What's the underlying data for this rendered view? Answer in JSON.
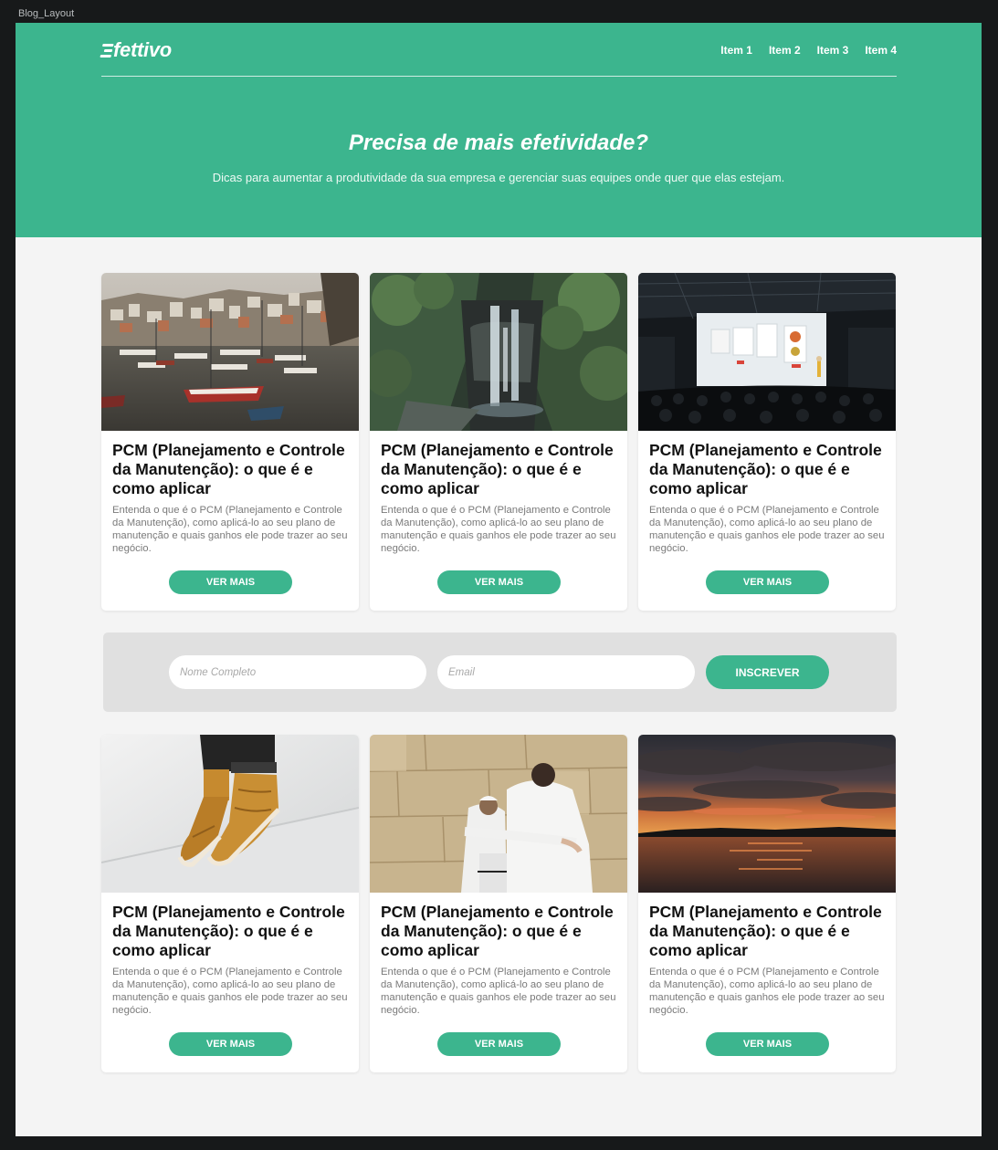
{
  "frame": {
    "label": "Blog_Layout"
  },
  "header": {
    "logo_text": "fettivo",
    "nav": [
      "Item 1",
      "Item 2",
      "Item 3",
      "Item 4"
    ]
  },
  "hero": {
    "title": "Precisa de mais efetividade?",
    "subtitle": "Dicas para aumentar a produtividade da sua empresa e gerenciar suas equipes onde quer que elas estejam."
  },
  "posts": [
    {
      "title": "PCM (Planejamento e Controle da Manutenção): o que é e como aplicar",
      "description": "Entenda o que é o PCM (Planejamento e Controle da Manutenção), como aplicá-lo ao seu plano de manutenção e quais ganhos ele pode trazer ao seu negócio.",
      "button": "VER MAIS",
      "image": "harbor-photo"
    },
    {
      "title": "PCM (Planejamento e Controle da Manutenção): o que é e como aplicar",
      "description": "Entenda o que é o PCM (Planejamento e Controle da Manutenção), como aplicá-lo ao seu plano de manutenção e quais ganhos ele pode trazer ao seu negócio.",
      "button": "VER MAIS",
      "image": "waterfall-photo"
    },
    {
      "title": "PCM (Planejamento e Controle da Manutenção): o que é e como aplicar",
      "description": "Entenda o que é o PCM (Planejamento e Controle da Manutenção), como aplicá-lo ao seu plano de manutenção e quais ganhos ele pode trazer ao seu negócio.",
      "button": "VER MAIS",
      "image": "conference-photo"
    },
    {
      "title": "PCM (Planejamento e Controle da Manutenção): o que é e como aplicar",
      "description": "Entenda o que é o PCM (Planejamento e Controle da Manutenção), como aplicá-lo ao seu plano de manutenção e quais ganhos ele pode trazer ao seu negócio.",
      "button": "VER MAIS",
      "image": "sneakers-photo"
    },
    {
      "title": "PCM (Planejamento e Controle da Manutenção): o que é e como aplicar",
      "description": "Entenda o que é o PCM (Planejamento e Controle da Manutenção), como aplicá-lo ao seu plano de manutenção e quais ganhos ele pode trazer ao seu negócio.",
      "button": "VER MAIS",
      "image": "wall-prayer-photo"
    },
    {
      "title": "PCM (Planejamento e Controle da Manutenção): o que é e como aplicar",
      "description": "Entenda o que é o PCM (Planejamento e Controle da Manutenção), como aplicá-lo ao seu plano de manutenção e quais ganhos ele pode trazer ao seu negócio.",
      "button": "VER MAIS",
      "image": "sunset-lake-photo"
    }
  ],
  "newsletter": {
    "name_placeholder": "Nome Completo",
    "email_placeholder": "Email",
    "button": "INSCREVER"
  },
  "colors": {
    "brand": "#3cb58e",
    "page_bg": "#f4f4f4",
    "newsletter_bg": "#e0e0e0"
  }
}
